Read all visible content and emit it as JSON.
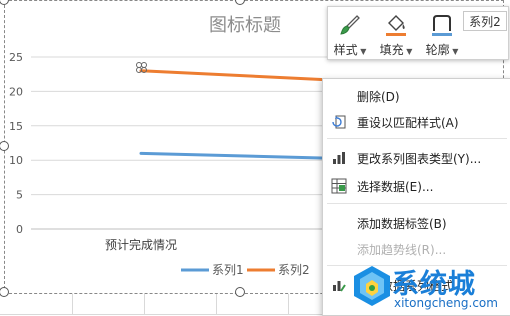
{
  "chart_data": {
    "type": "line",
    "title": "图标标题",
    "categories": [
      "预计完成情况"
    ],
    "series": [
      {
        "name": "系列1",
        "color": "#5b9bd5",
        "values": [
          11,
          10.2
        ]
      },
      {
        "name": "系列2",
        "color": "#ed7d31",
        "values": [
          23,
          21.5
        ]
      }
    ],
    "y_ticks": [
      "0",
      "5",
      "10",
      "15",
      "20",
      "25"
    ],
    "ylim": [
      0,
      25
    ],
    "grid": true,
    "legend_position": "bottom"
  },
  "format_toolbar": {
    "style_label": "样式",
    "fill_label": "填充",
    "outline_label": "轮廓",
    "series_selector": "系列2",
    "fill_color": "#ed7d31",
    "outline_color": "#5b9bd5"
  },
  "context_menu": {
    "items": [
      {
        "label": "删除(D)",
        "icon": "",
        "disabled": false
      },
      {
        "label": "重设以匹配样式(A)",
        "icon": "reset-style-icon",
        "disabled": false
      },
      {
        "label": "更改系列图表类型(Y)...",
        "icon": "chart-type-icon",
        "disabled": false
      },
      {
        "label": "选择数据(E)...",
        "icon": "select-data-icon",
        "disabled": false
      },
      {
        "label": "添加数据标签(B)",
        "icon": "",
        "disabled": false
      },
      {
        "label": "添加趋势线(R)...",
        "icon": "",
        "disabled": true
      },
      {
        "label": "设置数据系列格式",
        "icon": "format-series-icon",
        "disabled": false
      }
    ]
  },
  "watermark": {
    "main": "系统城",
    "sub": "xitongcheng.com"
  }
}
